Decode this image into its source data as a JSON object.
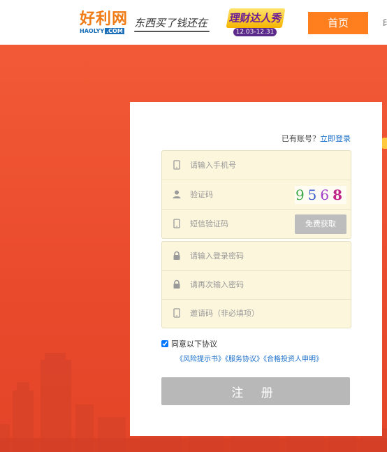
{
  "header": {
    "logo_text": "好利网",
    "logo_sub_a": "HAOLYY",
    "logo_sub_b": ".COM",
    "slogan": "东西买了钱还在",
    "promo_title": "理财达人秀",
    "promo_date": "12.03-12.31",
    "nav_home": "首页",
    "nav_next": "印"
  },
  "form": {
    "login_prompt": "已有账号？",
    "login_link": "立即登录",
    "phone_placeholder": "请输入手机号",
    "captcha_placeholder": "验证码",
    "captcha_digits": [
      "9",
      "5",
      "6",
      "8"
    ],
    "sms_placeholder": "短信验证码",
    "sms_button": "免费获取",
    "password_placeholder": "请输入登录密码",
    "password_confirm_placeholder": "请再次输入密码",
    "invite_placeholder": "邀请码（非必填项）",
    "agree_label": "同意以下协议",
    "agreements": [
      "《风险提示书》",
      "《服务协议》",
      "《合格投资人申明》"
    ],
    "submit_label": "注 册"
  },
  "colors": {
    "accent_orange": "#ff7f1f",
    "banner_red": "#ec4e2f",
    "input_bg": "#fcf6dd",
    "link_blue": "#1a6fc9",
    "disabled_gray": "#b8b8b8"
  },
  "icons": {
    "phone": "phone-icon",
    "user": "user-icon",
    "lock": "lock-icon",
    "checkbox": "checkbox-checked-icon"
  },
  "state": {
    "agree_checked": true
  }
}
